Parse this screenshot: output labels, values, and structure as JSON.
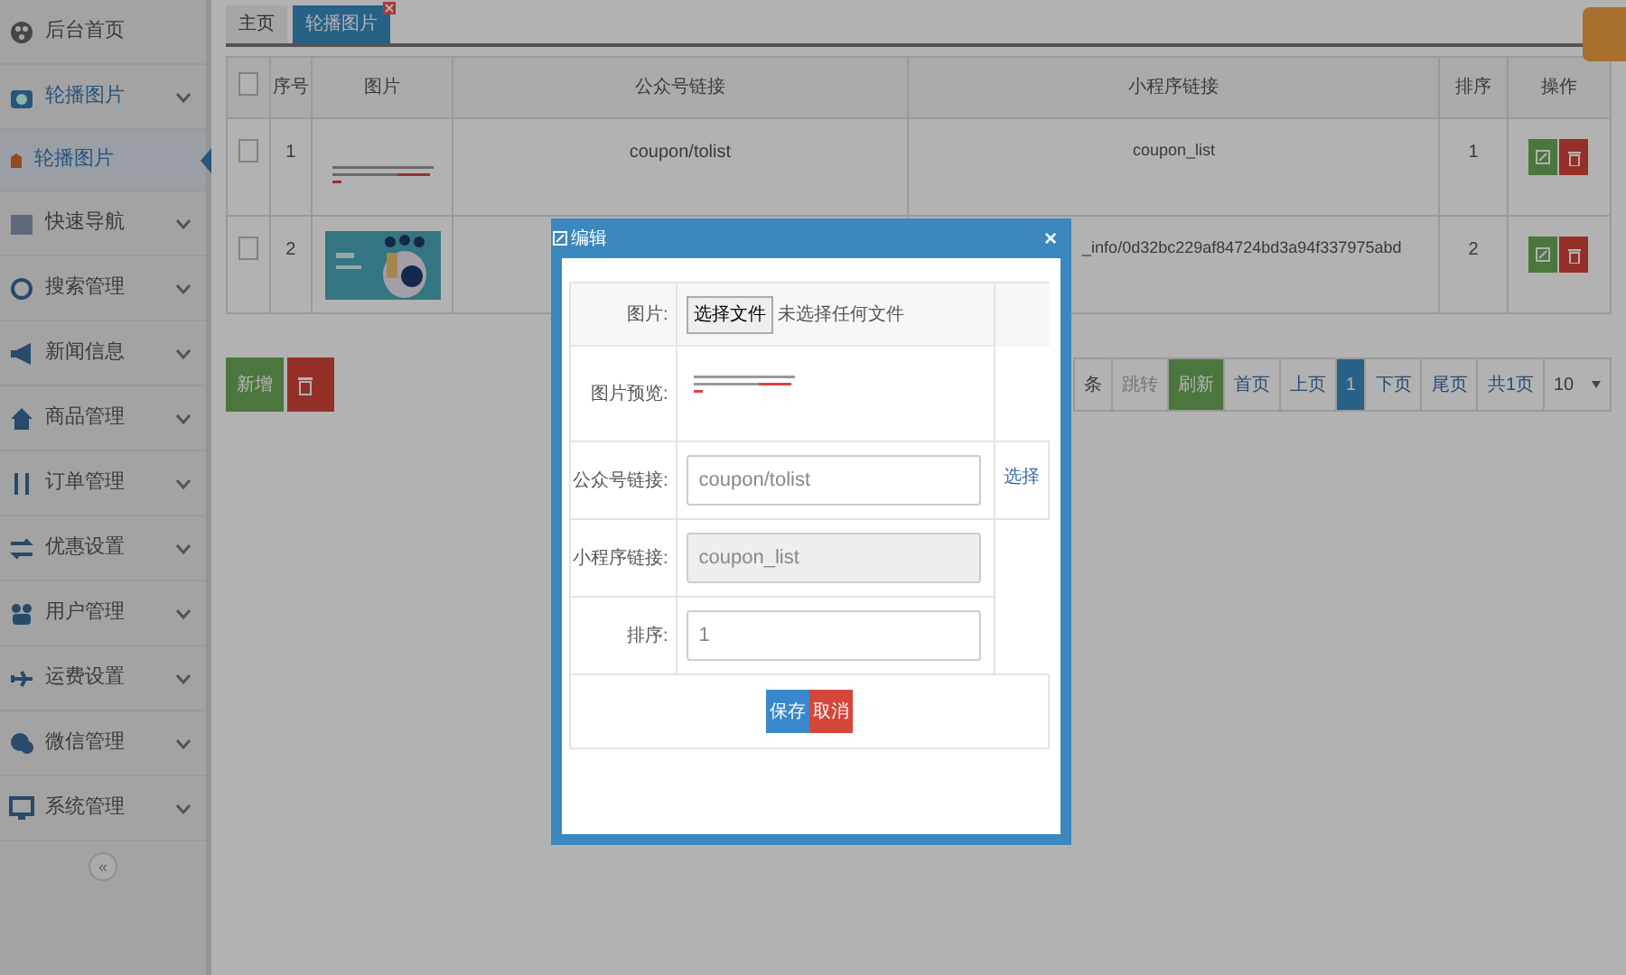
{
  "sidebar": {
    "items": [
      {
        "label": "后台首页",
        "kind": "link",
        "expanded": false
      },
      {
        "label": "轮播图片",
        "kind": "group",
        "expanded": true,
        "children": [
          {
            "label": "轮播图片",
            "selected": true
          }
        ]
      },
      {
        "label": "快速导航",
        "kind": "group",
        "expanded": false
      },
      {
        "label": "搜索管理",
        "kind": "group",
        "expanded": false
      },
      {
        "label": "新闻信息",
        "kind": "group",
        "expanded": false
      },
      {
        "label": "商品管理",
        "kind": "group",
        "expanded": false
      },
      {
        "label": "订单管理",
        "kind": "group",
        "expanded": false
      },
      {
        "label": "优惠设置",
        "kind": "group",
        "expanded": false
      },
      {
        "label": "用户管理",
        "kind": "group",
        "expanded": false
      },
      {
        "label": "运费设置",
        "kind": "group",
        "expanded": false
      },
      {
        "label": "微信管理",
        "kind": "group",
        "expanded": false
      },
      {
        "label": "系统管理",
        "kind": "group",
        "expanded": false
      }
    ],
    "collapse": "«"
  },
  "tabs": [
    {
      "label": "主页",
      "selected": false,
      "closable": false
    },
    {
      "label": "轮播图片",
      "selected": true,
      "closable": true
    }
  ],
  "table": {
    "select_all_checked": false,
    "columns": [
      "序号",
      "图片",
      "公众号链接",
      "小程序链接",
      "排序",
      "操作"
    ],
    "rows": [
      {
        "checked": false,
        "number": "1",
        "wechat_link": "coupon/tolist",
        "mini_link": "coupon_list",
        "sort": "1"
      },
      {
        "checked": false,
        "number": "2",
        "mini_link": "_info/0d32bc229af84724bd3a94f337975abd",
        "sort": "2"
      }
    ]
  },
  "actions": [
    {
      "kind": "add",
      "label": "新增"
    },
    {
      "kind": "delete"
    }
  ],
  "pagination": {
    "items": [
      {
        "kind": "text",
        "label": "条"
      },
      {
        "kind": "disabled",
        "label": "跳转"
      },
      {
        "kind": "action",
        "label": "刷新"
      },
      {
        "kind": "page",
        "label": "首页",
        "selected": false
      },
      {
        "kind": "page",
        "label": "上页",
        "selected": false
      },
      {
        "kind": "page",
        "label": "1",
        "selected": true
      },
      {
        "kind": "page",
        "label": "下页",
        "selected": false
      },
      {
        "kind": "page",
        "label": "尾页",
        "selected": false
      },
      {
        "kind": "page",
        "label": "共1页",
        "selected": false
      }
    ],
    "page_size": "10"
  },
  "modal": {
    "title": "编辑",
    "close": "×",
    "fields": [
      {
        "kind": "file",
        "label": "图片:",
        "button": "选择文件",
        "note": "未选择任何文件"
      },
      {
        "kind": "preview",
        "label": "图片预览:"
      },
      {
        "kind": "input",
        "label": "公众号链接:",
        "value": "coupon/tolist",
        "disabled": false,
        "link": "选择"
      },
      {
        "kind": "input",
        "label": "小程序链接:",
        "value": "coupon_list",
        "disabled": true
      },
      {
        "kind": "input",
        "label": "排序:",
        "value": "1",
        "disabled": false
      }
    ],
    "buttons": [
      {
        "kind": "primary",
        "label": "保存"
      },
      {
        "kind": "danger",
        "label": "取消"
      }
    ]
  }
}
